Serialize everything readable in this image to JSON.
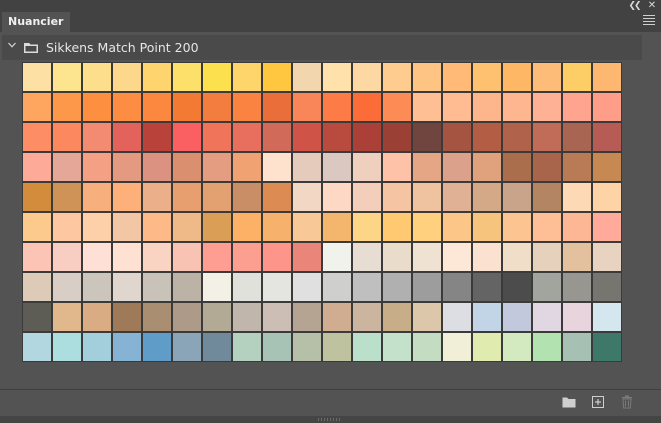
{
  "panel": {
    "tab_label": "Nuancier",
    "collapse_icon": "double-chevron-left-icon",
    "close_icon": "close-icon",
    "menu_icon": "panel-menu-icon"
  },
  "group": {
    "name": "Sikkens Match Point 200",
    "chevron_icon": "chevron-down-icon",
    "folder_icon": "folder-icon"
  },
  "swatches": [
    [
      "#fde0a4",
      "#fde590",
      "#fdde8c",
      "#fdd78b",
      "#fdd46d",
      "#fde069",
      "#fde04e",
      "#fed56a",
      "#ffc63f",
      "#f2d6ad",
      "#ffe1ac",
      "#fed8a3",
      "#fecc8e",
      "#fec483",
      "#feba76",
      "#fdc170",
      "#feb865",
      "#febc79",
      "#fece66",
      "#fdb770"
    ],
    [
      "#fea55f",
      "#fd984a",
      "#fd9040",
      "#fd8d42",
      "#fc873e",
      "#f27a33",
      "#f37d3e",
      "#fa8341",
      "#ea6e39",
      "#f98659",
      "#fd7b46",
      "#fb6c38",
      "#fd8b56",
      "#febf95",
      "#ffbc92",
      "#fdb58c",
      "#feb690",
      "#ffb195",
      "#ffa48f",
      "#fe9e88"
    ],
    [
      "#fc8d65",
      "#fc885f",
      "#f38a72",
      "#e4625c",
      "#b9423a",
      "#fa5f62",
      "#ef745a",
      "#e86e5e",
      "#d16a59",
      "#cf5347",
      "#b94a3e",
      "#ab4039",
      "#9a4035",
      "#704540",
      "#a55442",
      "#b35d44",
      "#b0624b",
      "#c16c58",
      "#a86652",
      "#b65c54"
    ],
    [
      "#fdaa98",
      "#e5a797",
      "#f4a084",
      "#e39a80",
      "#dc9281",
      "#da8f6f",
      "#e49d80",
      "#f1a272",
      "#fee2cd",
      "#e5cbbc",
      "#dbc9c1",
      "#efd0be",
      "#fdc2a7",
      "#e5a686",
      "#dba18b",
      "#e0a17d",
      "#ab6e4c",
      "#a9654b",
      "#b97b55",
      "#c88852"
    ],
    [
      "#d28c3c",
      "#cf9257",
      "#f8af7e",
      "#feb07b",
      "#ebb08a",
      "#e79f6f",
      "#e3a071",
      "#ca8e66",
      "#dc8b52",
      "#f2d7c4",
      "#fdd8c5",
      "#f3cfbb",
      "#f5c4a3",
      "#efc39f",
      "#e0b195",
      "#d4a987",
      "#c9a38a",
      "#b38563",
      "#fed9b5",
      "#fed3a6"
    ],
    [
      "#fdca8e",
      "#fcc7a1",
      "#fed0aa",
      "#f3c6a5",
      "#fdba88",
      "#efba88",
      "#db9e56",
      "#fcb167",
      "#f6b16d",
      "#f9c897",
      "#f4b66c",
      "#fdd587",
      "#ffc971",
      "#ffd17e",
      "#fcc689",
      "#f6c47c",
      "#fbc490",
      "#febf97",
      "#feb794",
      "#ffaa9a"
    ],
    [
      "#fcc4b4",
      "#f9cec2",
      "#ffe0d7",
      "#fee1d3",
      "#fad4c3",
      "#f9c3b3",
      "#fe9d92",
      "#fd9f90",
      "#fe958a",
      "#ea8679",
      "#f2f2ec",
      "#e7ddd3",
      "#e9dccb",
      "#f0e2d3",
      "#fde8d7",
      "#fbe1cf",
      "#f0dec8",
      "#e5d1bc",
      "#e3c09e",
      "#e8d3c0"
    ],
    [
      "#ddcbb7",
      "#d9cec6",
      "#ccc5bc",
      "#e0d6cd",
      "#c9c2b9",
      "#bdb2a6",
      "#f3f1e6",
      "#e1e1db",
      "#e4e4e0",
      "#e0e0e0",
      "#cfcfcd",
      "#bfbfbf",
      "#b0b0b0",
      "#9d9d9d",
      "#858585",
      "#646464",
      "#4c4c4c",
      "#a2a59e",
      "#979690",
      "#767570"
    ],
    [
      "#5e5d55",
      "#e0b88c",
      "#d9ac84",
      "#9f7a58",
      "#aa8e72",
      "#ae9a88",
      "#b2aa94",
      "#c0b6ac",
      "#ccbeb4",
      "#b6a493",
      "#d0ac90",
      "#cbb59f",
      "#c8ad89",
      "#dcc7ab",
      "#dddee4",
      "#c1d5e7",
      "#c2c9dd",
      "#e0d7e3",
      "#e7d4dd",
      "#d4e7ee"
    ],
    [
      "#b3d7e1",
      "#acdee0",
      "#a3cfdd",
      "#86b2d3",
      "#5f9cc7",
      "#89a5b7",
      "#708a9b",
      "#b4d0bf",
      "#a6c3b5",
      "#b6c0a9",
      "#bec29e",
      "#bae0cc",
      "#c4e1cb",
      "#c4ddc2",
      "#f1efd8",
      "#e0ecaf",
      "#d3e9c0",
      "#b2e2af",
      "#a6c1b3",
      "#3e7868"
    ]
  ],
  "footer": {
    "new_group_icon": "folder-icon",
    "new_swatch_icon": "new-swatch-icon",
    "delete_icon": "trash-icon"
  }
}
